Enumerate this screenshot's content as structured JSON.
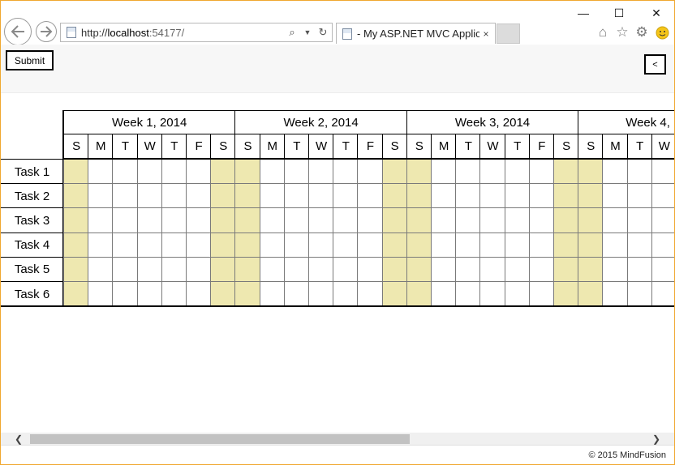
{
  "browser": {
    "url_prefix": "http://",
    "url_host": "localhost",
    "url_rest": ":54177/",
    "tab_title": "- My ASP.NET MVC Applica...",
    "tab_close": "×",
    "icons": [
      "back-icon",
      "forward-icon",
      "search-icon",
      "refresh-icon",
      "home-icon",
      "favorites-star-icon",
      "settings-gear-icon",
      "feedback-smiley-icon"
    ]
  },
  "toolbar": {
    "submit_label": "Submit",
    "collapse_label": "<"
  },
  "timeline": {
    "weeks": [
      "Week 1, 2014",
      "Week 2, 2014",
      "Week 3, 2014",
      "Week 4,"
    ],
    "days": [
      "S",
      "M",
      "T",
      "W",
      "T",
      "F",
      "S"
    ],
    "last_week_days": [
      "S",
      "M",
      "T",
      "W"
    ],
    "weekend_color": "#eee8b0",
    "tasks": [
      "Task 1",
      "Task 2",
      "Task 3",
      "Task 4",
      "Task 5",
      "Task 6"
    ]
  },
  "footer": {
    "copyright": "© 2015 MindFusion"
  }
}
